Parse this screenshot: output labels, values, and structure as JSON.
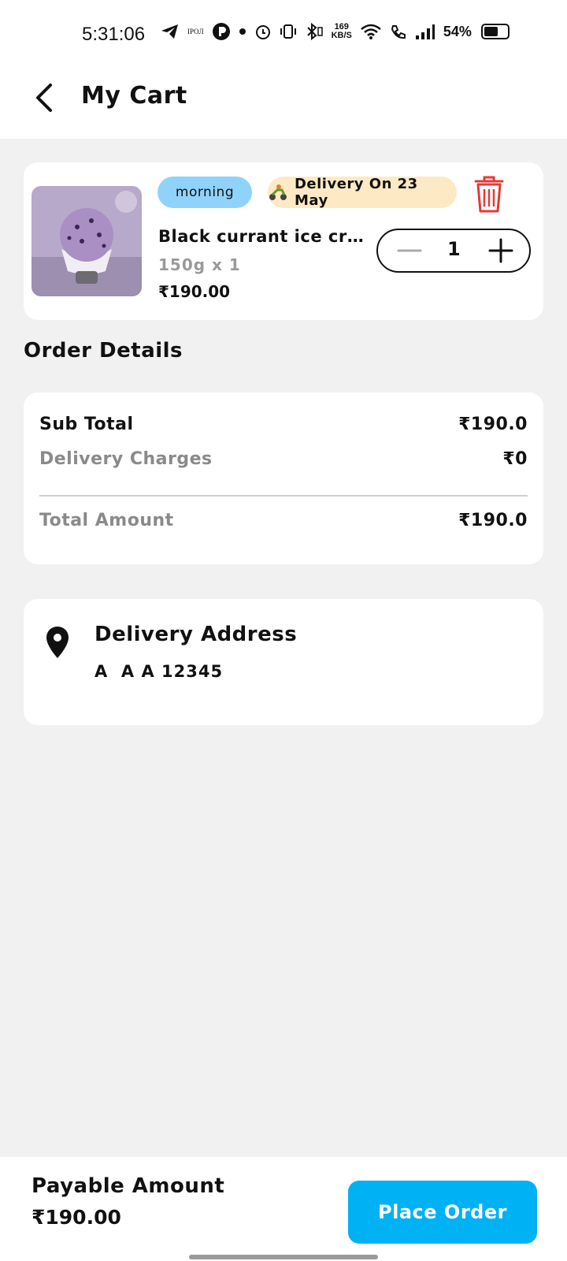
{
  "status_bar": {
    "time": "5:31:06",
    "carrier_mini": "IPOЛ",
    "speed_value": "169",
    "speed_unit": "KB/S",
    "battery": "54%"
  },
  "header": {
    "title": "My Cart",
    "back_icon": "chevron-left-icon"
  },
  "cart_item": {
    "slot": "morning",
    "delivery_label": "Delivery On 23 May",
    "name": "Black currant ice crea...",
    "quantity_text": "150g x 1",
    "price": "₹190.00",
    "count": "1",
    "colors": {
      "slot_bg": "#8fd3fb",
      "delivery_bg": "#fde9c4",
      "trash": "#e53935"
    }
  },
  "order_details": {
    "title": "Order Details",
    "sub_total_label": "Sub Total",
    "sub_total_value": "₹190.0",
    "delivery_label": "Delivery Charges",
    "delivery_value": "₹0",
    "total_label": "Total Amount",
    "total_value": "₹190.0"
  },
  "address": {
    "title": "Delivery Address",
    "line": "A  A A 12345"
  },
  "footer": {
    "payable_label": "Payable Amount",
    "payable_value": "₹190.00",
    "place_order": "Place Order",
    "accent": "#00b2f4"
  }
}
